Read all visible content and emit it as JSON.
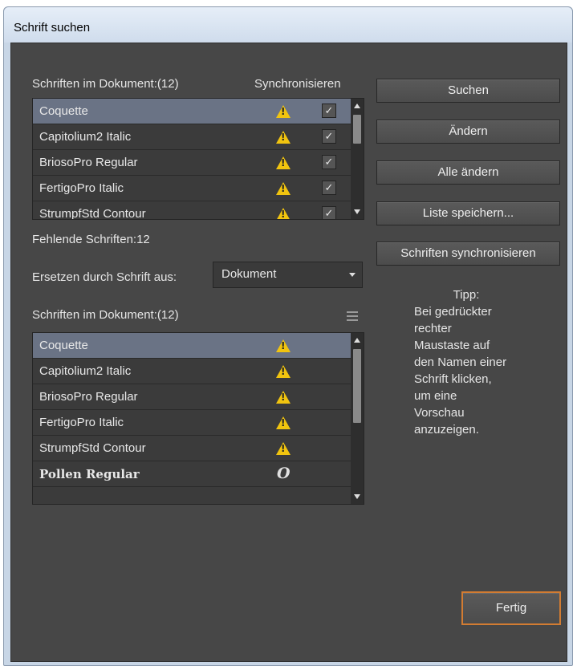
{
  "window": {
    "title": "Schrift suchen"
  },
  "top_list": {
    "header": "Schriften im Dokument:(12)",
    "sync_header": "Synchronisieren",
    "rows": [
      {
        "name": "Coquette",
        "status_icon": "warning-icon",
        "synced": true,
        "selected": true
      },
      {
        "name": "Capitolium2 Italic",
        "status_icon": "warning-icon",
        "synced": true
      },
      {
        "name": "BriosoPro Regular",
        "status_icon": "warning-icon",
        "synced": true
      },
      {
        "name": "FertigoPro Italic",
        "status_icon": "warning-icon",
        "synced": true
      },
      {
        "name": "StrumpfStd Contour",
        "status_icon": "warning-icon",
        "synced": true
      }
    ],
    "check_mark": "✓"
  },
  "missing_label": "Fehlende Schriften:12",
  "replace": {
    "label": "Ersetzen durch Schrift aus:",
    "value": "Dokument"
  },
  "bottom_list": {
    "header": "Schriften im Dokument:(12)",
    "rows": [
      {
        "name": "Coquette",
        "status_icon": "warning-icon",
        "selected": true
      },
      {
        "name": "Capitolium2 Italic",
        "status_icon": "warning-icon"
      },
      {
        "name": "BriosoPro Regular",
        "status_icon": "warning-icon"
      },
      {
        "name": "FertigoPro Italic",
        "status_icon": "warning-icon"
      },
      {
        "name": "StrumpfStd Contour",
        "status_icon": "warning-icon"
      },
      {
        "name": "Pollen Regular",
        "status_icon": "opentype-icon",
        "glyph": "O"
      }
    ]
  },
  "buttons": {
    "suchen": "Suchen",
    "aendern": "Ändern",
    "alle_aendern": "Alle ändern",
    "liste_speichern": "Liste speichern...",
    "schriften_sync": "Schriften synchronisieren",
    "fertig": "Fertig"
  },
  "tipp": {
    "title": "Tipp:",
    "lines": [
      "Bei gedrückter",
      "rechter",
      "Maustaste auf",
      "den Namen einer",
      "Schrift klicken,",
      "um eine",
      "Vorschau",
      "anzuzeigen."
    ]
  },
  "colors": {
    "accent": "#d27c32",
    "warning": "#f1c40f",
    "panel": "#474747",
    "selected_row": "#6a7385"
  }
}
